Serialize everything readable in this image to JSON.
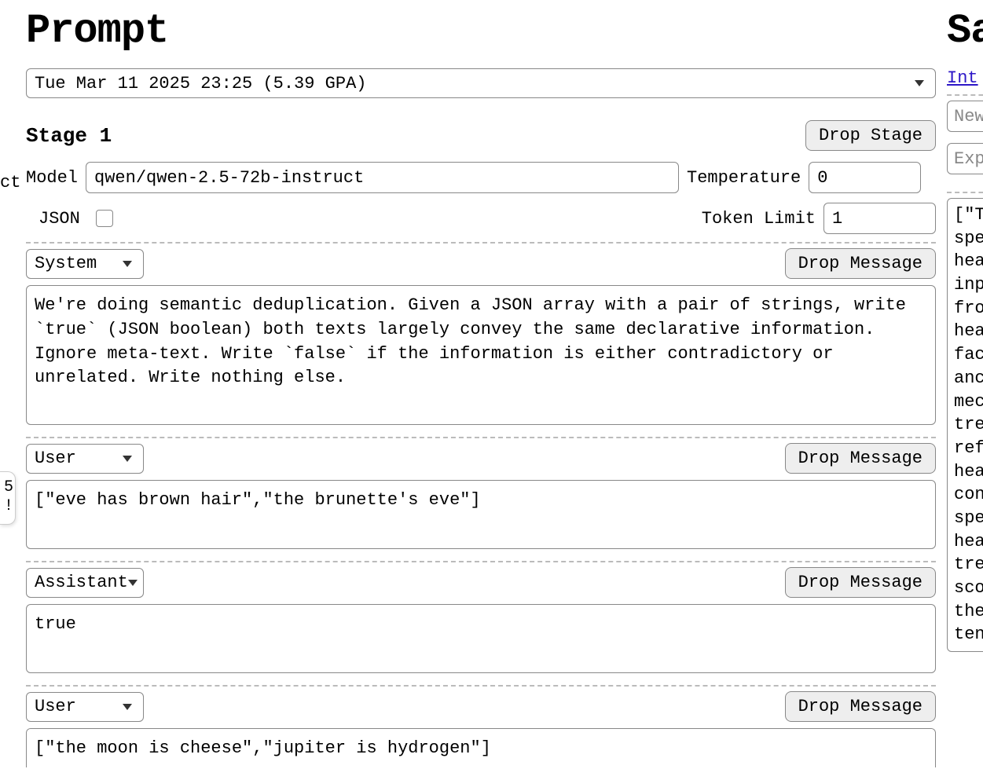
{
  "headings": {
    "prompt": "Prompt",
    "samples_partial": "Sa"
  },
  "left_cutoff_label": "ct",
  "dropdown": {
    "selected": "Tue Mar 11 2025 23:25 (5.39 GPA)"
  },
  "stage": {
    "label": "Stage 1",
    "drop_button": "Drop Stage"
  },
  "settings": {
    "model_label": "Model",
    "model_value": "qwen/qwen-2.5-72b-instruct",
    "temperature_label": "Temperature",
    "temperature_value": "0",
    "json_label": "JSON",
    "json_checked": false,
    "token_limit_label": "Token Limit",
    "token_limit_value": "1"
  },
  "messages": [
    {
      "role": "System",
      "drop_label": "Drop Message",
      "content": "We're doing semantic deduplication. Given a JSON array with a pair of strings, write `true` (JSON boolean) both texts largely convey the same declarative information. Ignore meta-text. Write `false` if the information is either contradictory or unrelated. Write nothing else."
    },
    {
      "role": "User",
      "drop_label": "Drop Message",
      "content": "[\"eve has brown hair\",\"the brunette's eve\"]"
    },
    {
      "role": "Assistant",
      "drop_label": "Drop Message",
      "content": "true"
    },
    {
      "role": "User",
      "drop_label": "Drop Message",
      "content": "[\"the moon is cheese\",\"jupiter is hydrogen\"]"
    }
  ],
  "right": {
    "link_partial": "Int",
    "new_placeholder": "New",
    "exp_placeholder": "Exp",
    "sample_text": "[\"T\nspe\nhea\ninp\nfro\nhea\nfac\nanc\nmec\ntre\nref\nhea\ncon\nspe\nhea\ntre\nsco\nthe\nten"
  },
  "badge": {
    "line1": "5",
    "line2": "!"
  }
}
